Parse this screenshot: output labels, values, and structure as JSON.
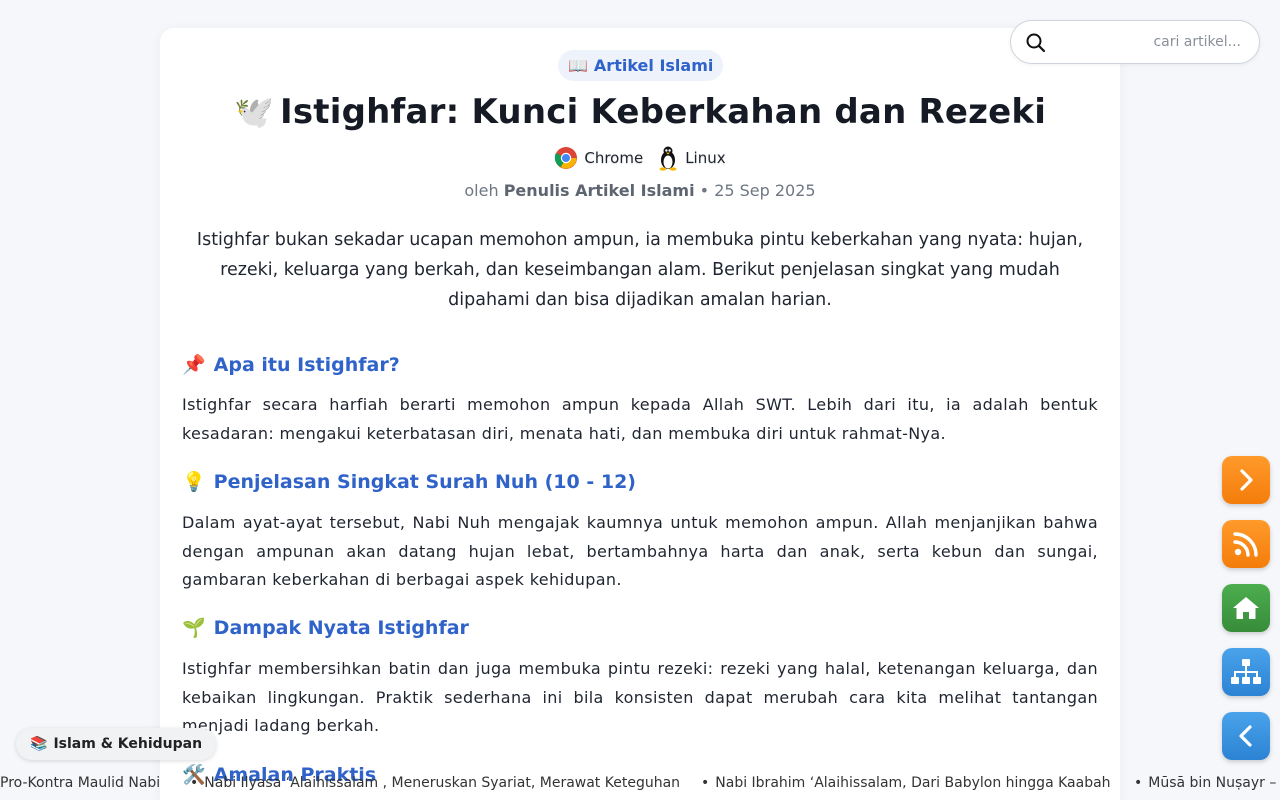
{
  "category": {
    "icon": "book-icon",
    "label": "Artikel Islami"
  },
  "article": {
    "title": "Istighfar: Kunci Keberkahan dan Rezeki",
    "platforms": [
      {
        "icon": "chrome-icon",
        "label": "Chrome"
      },
      {
        "icon": "linux-icon",
        "label": "Linux"
      }
    ],
    "byline": {
      "prefix": "oleh",
      "author": "Penulis Artikel Islami",
      "separator": "•",
      "date": "25 Sep 2025"
    },
    "intro": "Istighfar bukan sekadar ucapan memohon ampun, ia membuka pintu keberkahan yang nyata: hujan, rezeki, keluarga yang berkah, dan keseimbangan alam. Berikut penjelasan singkat yang mudah dipahami dan bisa dijadikan amalan harian.",
    "sections": [
      {
        "emoji": "📌",
        "heading": "Apa itu Istighfar?",
        "text": "Istighfar secara harfiah berarti memohon ampun kepada Allah SWT. Lebih dari itu, ia adalah bentuk kesadaran: mengakui keterbatasan diri, menata hati, dan membuka diri untuk rahmat-Nya."
      },
      {
        "emoji": "💡",
        "heading": "Penjelasan Singkat Surah Nuh (10 - 12)",
        "text": "Dalam ayat-ayat tersebut, Nabi Nuh mengajak kaumnya untuk memohon ampun. Allah menjanjikan bahwa dengan ampunan akan datang hujan lebat, bertambahnya harta dan anak, serta kebun dan sungai, gambaran keberkahan di berbagai aspek kehidupan."
      },
      {
        "emoji": "🌱",
        "heading": "Dampak Nyata Istighfar",
        "text": "Istighfar membersihkan batin dan juga membuka pintu rezeki: rezeki yang halal, ketenangan keluarga, dan kebaikan lingkungan. Praktik sederhana ini bila konsisten dapat merubah cara kita melihat tantangan menjadi ladang berkah."
      },
      {
        "emoji": "🛠️",
        "heading": "Amalan Praktis",
        "text": ""
      }
    ]
  },
  "search": {
    "placeholder": "cari artikel...",
    "value": ""
  },
  "fabs": [
    {
      "name": "next-button",
      "icon": "chevron-right-icon",
      "color": "#f7891a"
    },
    {
      "name": "rss-button",
      "icon": "rss-icon",
      "color": "#f7891a"
    },
    {
      "name": "home-button",
      "icon": "home-icon",
      "color": "#43a047"
    },
    {
      "name": "sitemap-button",
      "icon": "sitemap-icon",
      "color": "#3a93e0"
    },
    {
      "name": "back-button",
      "icon": "chevron-left-icon",
      "color": "#3a93e0"
    }
  ],
  "tag": {
    "icon": "books-icon",
    "label": "Islam & Kehidupan"
  },
  "ticker": [
    {
      "bullet": "",
      "text": "Pro-Kontra Maulid Nabi"
    },
    {
      "bullet": "•",
      "text": "Nabi Ilyasa ‘Alaihissalam , Meneruskan Syariat, Merawat Keteguhan"
    },
    {
      "bullet": "•",
      "text": "Nabi Ibrahim ‘Alaihissalam, Dari Babylon hingga Kaabah"
    },
    {
      "bullet": "•",
      "text": "Mūsā bin Nuṣayr – M"
    }
  ],
  "colors": {
    "accent": "#2f63c9",
    "fab_orange": "#f7891a",
    "fab_green": "#43a047",
    "fab_blue": "#3a93e0"
  }
}
